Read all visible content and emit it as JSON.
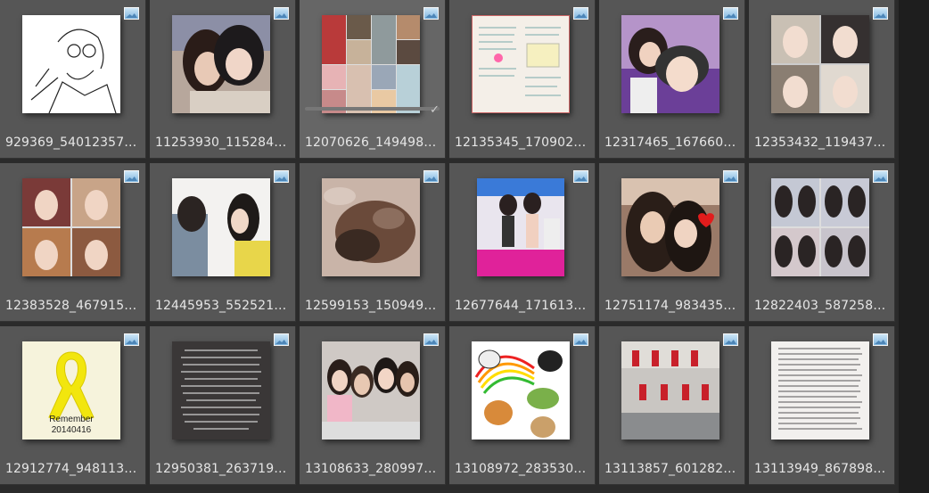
{
  "grid": {
    "items": [
      {
        "filename": "929369_54012357…",
        "thumb": "sketch",
        "selected": false
      },
      {
        "filename": "11253930_115284…",
        "thumb": "twogirls",
        "selected": false
      },
      {
        "filename": "12070626_149498…",
        "thumb": "collage",
        "selected": true
      },
      {
        "filename": "12135345_170902…",
        "thumb": "notes",
        "selected": false
      },
      {
        "filename": "12317465_167660…",
        "thumb": "selfie",
        "selected": false
      },
      {
        "filename": "12353432_119437…",
        "thumb": "collage2",
        "selected": false
      },
      {
        "filename": "12383528_467915…",
        "thumb": "collage3",
        "selected": false
      },
      {
        "filename": "12445953_552521…",
        "thumb": "makeup",
        "selected": false
      },
      {
        "filename": "12599153_150949…",
        "thumb": "stone",
        "selected": false
      },
      {
        "filename": "12677644_171613…",
        "thumb": "booth",
        "selected": false
      },
      {
        "filename": "12751174_983435…",
        "thumb": "kiss",
        "selected": false
      },
      {
        "filename": "12822403_587258…",
        "thumb": "collage4",
        "selected": false
      },
      {
        "filename": "12912774_948113…",
        "thumb": "ribbon",
        "selected": false
      },
      {
        "filename": "12950381_263719…",
        "thumb": "textdark",
        "selected": false
      },
      {
        "filename": "13108633_280997…",
        "thumb": "group",
        "selected": false
      },
      {
        "filename": "13108972_283530…",
        "thumb": "cartoon",
        "selected": false
      },
      {
        "filename": "13113857_601282…",
        "thumb": "dancers",
        "selected": false
      },
      {
        "filename": "13113949_867898…",
        "thumb": "textlight",
        "selected": false
      }
    ],
    "ribbon_text": [
      "Remember",
      "20140416"
    ],
    "badge_icon": "image-file-icon",
    "check_icon": "check-icon"
  }
}
